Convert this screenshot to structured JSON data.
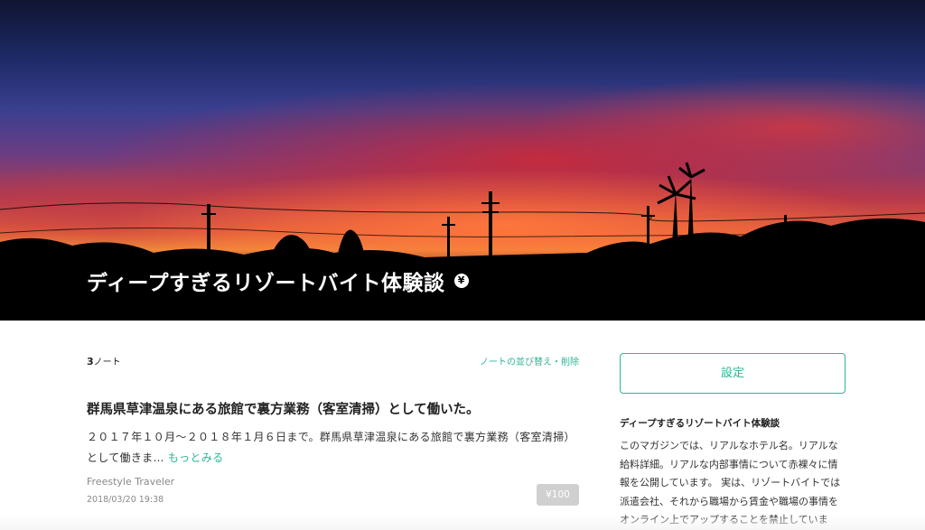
{
  "hero": {
    "title": "ディープすぎるリゾートバイト体験談",
    "paid_badge": "¥",
    "image": "sunset-sky-with-palm-and-utility-pole-silhouettes"
  },
  "main": {
    "note_count_number": "3",
    "note_count_unit": "ノート",
    "sort_link": "ノートの並び替え・削除",
    "article": {
      "title": "群馬県草津温泉にある旅館で裏方業務（客室清掃）として働いた。",
      "excerpt": "２０１７年１０月〜２０１８年１月６日まで。群馬県草津温泉にある旅館で裏方業務（客室清掃）として働きま…",
      "read_more": "もっとみる",
      "author": "Freestyle Traveler",
      "date": "2018/03/20 19:38",
      "price": "¥100"
    }
  },
  "sidebar": {
    "settings_button": "設定",
    "title": "ディープすぎるリゾートバイト体験談",
    "description": "このマガジンでは、リアルなホテル名。リアルな給料詳細。リアルな内部事情について赤裸々に情報を公開しています。 実は、リゾートバイトでは派遣会社、それから職場から賃金や職場の事情をオンライン上でアップすることを禁止していま"
  },
  "colors": {
    "accent": "#2cb696",
    "price_badge_bg": "#d0d0d0",
    "text": "#222222",
    "muted": "#888888"
  }
}
